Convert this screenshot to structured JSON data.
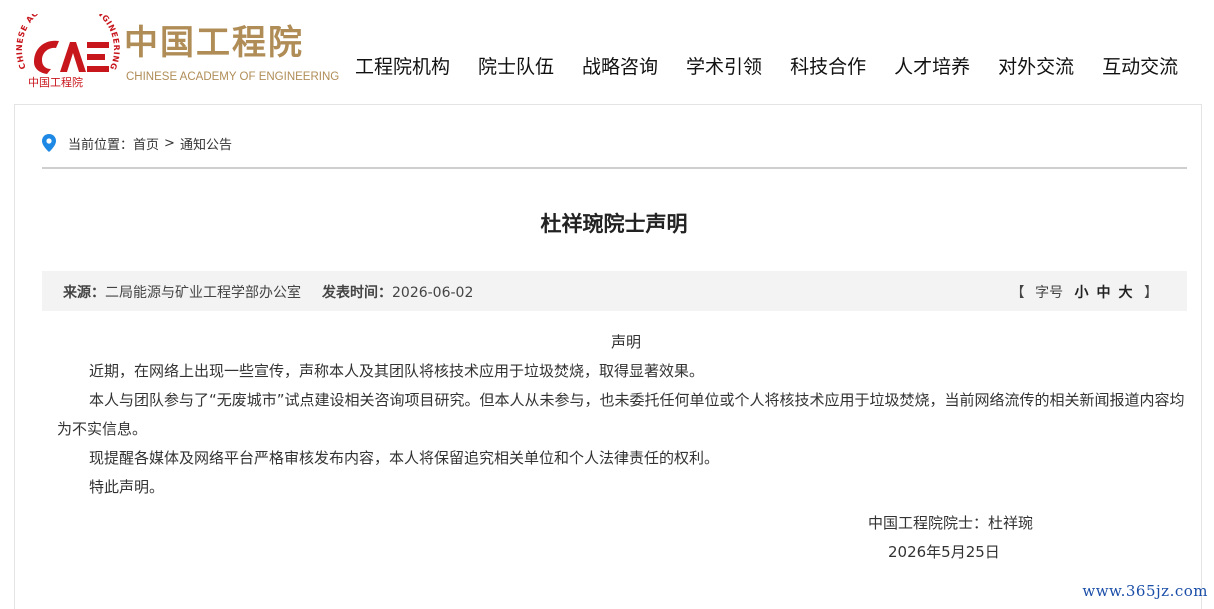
{
  "header": {
    "logo_text_cn": "中国工程院",
    "logo_text_en": "CHINESE ACADEMY OF ENGINEERING",
    "logo_ring_text": "CHINESE ACADEMY OF ENGINEERING",
    "logo_small_cn": "中国工程院",
    "nav": [
      "工程院机构",
      "院士队伍",
      "战略咨询",
      "学术引领",
      "科技合作",
      "人才培养",
      "对外交流",
      "互动交流"
    ]
  },
  "breadcrumb": {
    "prefix": "当前位置：",
    "home": "首页",
    "separator": ">",
    "current": "通知公告"
  },
  "article": {
    "title": "杜祥琬院士声明",
    "source_label": "来源：",
    "source": "二局能源与矿业工程学部办公室",
    "date_label": "发表时间：",
    "date": "2026-06-02",
    "font_size": {
      "open": "【",
      "label": "字号",
      "small": "小",
      "medium": "中",
      "large": "大",
      "close": "】"
    },
    "heading": "声明",
    "paragraphs": [
      "近期，在网络上出现一些宣传，声称本人及其团队将核技术应用于垃圾焚烧，取得显著效果。",
      "本人与团队参与了“无废城市”试点建设相关咨询项目研究。但本人从未参与，也未委托任何单位或个人将核技术应用于垃圾焚烧，当前网络流传的相关新闻报道内容均为不实信息。",
      "现提醒各媒体及网络平台严格审核发布内容，本人将保留追究相关单位和个人法律责任的权利。",
      "特此声明。"
    ],
    "signature": "中国工程院院士：杜祥琬",
    "sign_date": "2026年5月25日"
  },
  "watermark": "www.365jz.com",
  "colors": {
    "logo_red": "#c8161d",
    "logo_gold": "#b08d57",
    "pin_blue": "#1e88e5",
    "watermark_blue": "#1a4ea8"
  }
}
